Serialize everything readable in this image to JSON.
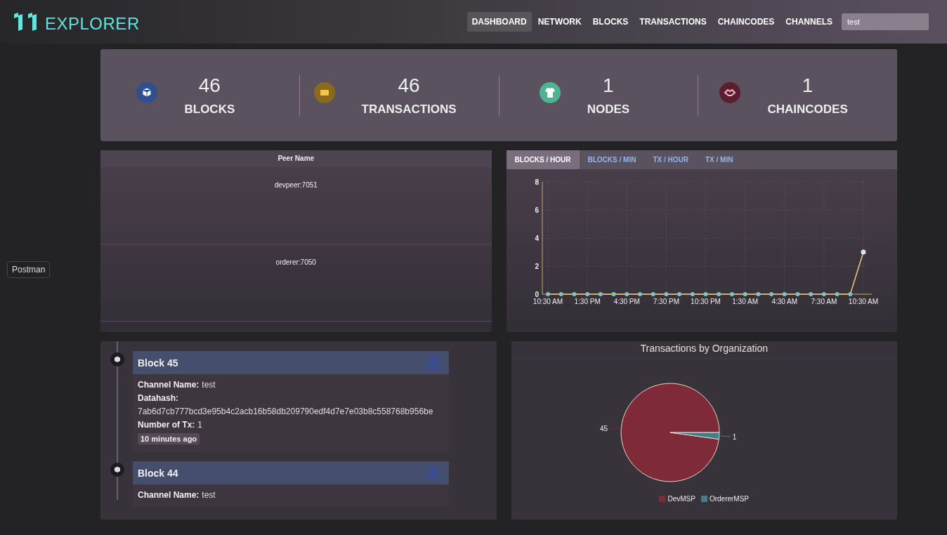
{
  "header": {
    "logo_text": "EXPLORER",
    "nav": [
      {
        "label": "DASHBOARD",
        "selected": true
      },
      {
        "label": "NETWORK",
        "selected": false
      },
      {
        "label": "BLOCKS",
        "selected": false
      },
      {
        "label": "TRANSACTIONS",
        "selected": false
      },
      {
        "label": "CHAINCODES",
        "selected": false
      },
      {
        "label": "CHANNELS",
        "selected": false
      }
    ],
    "channel_field": {
      "value": "test"
    }
  },
  "side_button": {
    "label": "Postman"
  },
  "stats": [
    {
      "kind": "blocks",
      "value": "46",
      "label": "BLOCKS",
      "color": "#2f4f8f"
    },
    {
      "kind": "transactions",
      "value": "46",
      "label": "TRANSACTIONS",
      "color": "#8a6a1c"
    },
    {
      "kind": "nodes",
      "value": "1",
      "label": "NODES",
      "color": "#4fb391"
    },
    {
      "kind": "chaincodes",
      "value": "1",
      "label": "CHAINCODES",
      "color": "#5a1e30"
    }
  ],
  "peers": {
    "columns": [
      "Peer Name"
    ],
    "rows": [
      "devpeer:7051",
      "orderer:7050"
    ]
  },
  "activity_chart": {
    "tabs": [
      {
        "label": "BLOCKS / HOUR",
        "selected": true
      },
      {
        "label": "BLOCKS / MIN",
        "selected": false
      },
      {
        "label": "TX / HOUR",
        "selected": false
      },
      {
        "label": "TX / MIN",
        "selected": false
      }
    ],
    "chart_data": {
      "type": "line",
      "categories": [
        "10:30 AM",
        null,
        null,
        "1:30 PM",
        null,
        null,
        "4:30 PM",
        null,
        null,
        "7:30 PM",
        null,
        null,
        "10:30 PM",
        null,
        null,
        "1:30 AM",
        null,
        null,
        "4:30 AM",
        null,
        null,
        "7:30 AM",
        null,
        null,
        "10:30 AM"
      ],
      "values": [
        0,
        0,
        0,
        0,
        0,
        0,
        0,
        0,
        0,
        0,
        0,
        0,
        0,
        0,
        0,
        0,
        0,
        0,
        0,
        0,
        0,
        0,
        0,
        0,
        3
      ],
      "ylim": [
        0,
        8
      ],
      "yticks": [
        0,
        2,
        4,
        6,
        8
      ],
      "grid": true,
      "marker": true
    }
  },
  "timeline": [
    {
      "title": "Block 45",
      "fields": [
        {
          "kind": "inline",
          "label": "Channel Name:",
          "value": "test"
        },
        {
          "kind": "stacked",
          "label": "Datahash:",
          "value": "7ab6d7cb777bcd3e95b4c2acb16b58db209790edf4d7e7e03b8c558768b956be"
        },
        {
          "kind": "inline",
          "label": "Number of Tx:",
          "value": "1"
        }
      ],
      "time": "10 minutes ago"
    },
    {
      "title": "Block 44",
      "fields": [
        {
          "kind": "inline",
          "label": "Channel Name:",
          "value": "test"
        }
      ]
    }
  ],
  "org_chart": {
    "chart_data": {
      "type": "pie",
      "title": "Transactions by Organization",
      "categories": [
        "DevMSP",
        "OrdererMSP"
      ],
      "values": [
        45,
        1
      ],
      "data_labels": true,
      "legend": "bottom"
    }
  }
}
